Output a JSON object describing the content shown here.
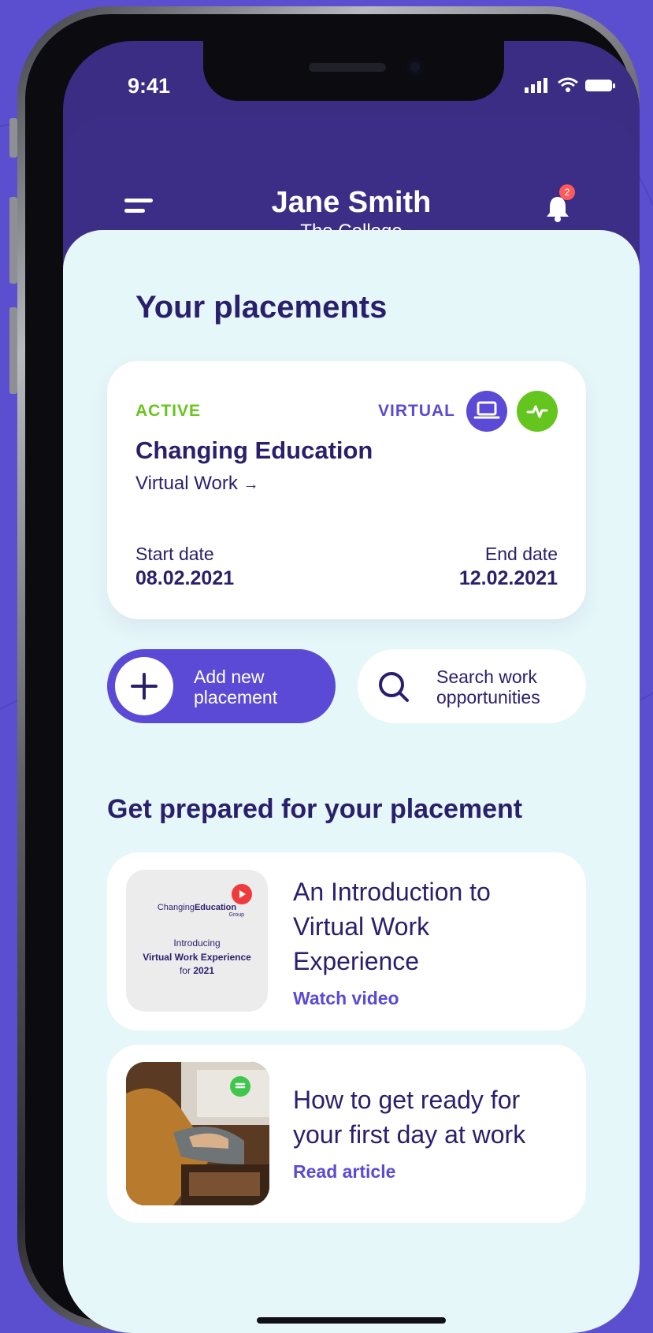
{
  "status_bar": {
    "time": "9:41"
  },
  "header": {
    "user_name": "Jane Smith",
    "organization": "The College",
    "notification_count": "2"
  },
  "placements": {
    "section_title": "Your placements",
    "card": {
      "status": "ACTIVE",
      "mode": "VIRTUAL",
      "company": "Changing Education",
      "type_link": "Virtual Work",
      "start_label": "Start date",
      "start_value": "08.02.2021",
      "end_label": "End date",
      "end_value": "12.02.2021"
    }
  },
  "actions": {
    "add_line1": "Add new",
    "add_line2": "placement",
    "search_line1": "Search work",
    "search_line2": "opportunities"
  },
  "prepare": {
    "section_title": "Get prepared for your placement",
    "items": [
      {
        "title_line1": "An Introduction to",
        "title_line2": "Virtual Work",
        "title_line3": "Experience",
        "link": "Watch video",
        "thumb_logo_a": "Changing",
        "thumb_logo_b": "Education",
        "thumb_logo_c": "Group",
        "thumb_intro": "Introducing",
        "thumb_vwe": "Virtual Work Experience",
        "thumb_for": "for",
        "thumb_year": "2021"
      },
      {
        "title_line1": "How to get ready for",
        "title_line2": "your first day at work",
        "link": "Read article"
      }
    ]
  },
  "colors": {
    "brand_purple": "#5a4ad6",
    "header_navy": "#3c2e86",
    "active_green": "#67c51c",
    "content_bg": "#e6f7f9",
    "text_dark": "#2a1f6b"
  },
  "icons": [
    "menu-icon",
    "bell-icon",
    "laptop-icon",
    "activity-icon",
    "plus-icon",
    "search-icon",
    "play-icon",
    "document-icon"
  ]
}
